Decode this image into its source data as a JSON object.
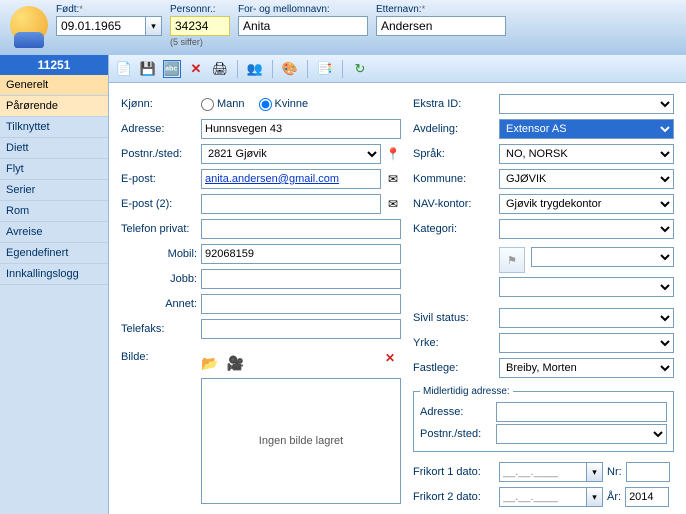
{
  "header": {
    "fodt_label": "Født:",
    "fodt_value": "09.01.1965",
    "personnr_label": "Personnr.:",
    "personnr_value": "34234",
    "personnr_hint": "(5 siffer)",
    "fornavn_label": "For- og mellomnavn:",
    "fornavn_value": "Anita",
    "etternavn_label": "Etternavn:",
    "etternavn_value": "Andersen",
    "required_marker": "*"
  },
  "sidebar": {
    "id": "11251",
    "items": [
      {
        "label": "Generelt",
        "active": true
      },
      {
        "label": "Pårørende",
        "highlight": true
      },
      {
        "label": "Tilknyttet"
      },
      {
        "label": "Diett"
      },
      {
        "label": "Flyt"
      },
      {
        "label": "Serier"
      },
      {
        "label": "Rom"
      },
      {
        "label": "Avreise"
      },
      {
        "label": "Egendefinert"
      },
      {
        "label": "Innkallingslogg"
      }
    ]
  },
  "toolbar_icons": [
    "new",
    "save",
    "card",
    "delete",
    "print",
    "users",
    "palette",
    "transfer",
    "refresh"
  ],
  "form_left": {
    "kjonn_label": "Kjønn:",
    "kjonn_mann": "Mann",
    "kjonn_kvinne": "Kvinne",
    "kjonn_value": "Kvinne",
    "adresse_label": "Adresse:",
    "adresse_value": "Hunnsvegen 43",
    "postnr_label": "Postnr./sted:",
    "postnr_value": "2821 Gjøvik",
    "epost_label": "E-post:",
    "epost_value": "anita.andersen@gmail.com",
    "epost2_label": "E-post (2):",
    "epost2_value": "",
    "telefon_label": "Telefon privat:",
    "telefon_value": "",
    "mobil_label": "Mobil:",
    "mobil_value": "92068159",
    "jobb_label": "Jobb:",
    "jobb_value": "",
    "annet_label": "Annet:",
    "annet_value": "",
    "telefaks_label": "Telefaks:",
    "telefaks_value": "",
    "bilde_label": "Bilde:",
    "bilde_placeholder": "Ingen bilde lagret"
  },
  "form_right": {
    "ekstraid_label": "Ekstra ID:",
    "ekstraid_value": "",
    "avdeling_label": "Avdeling:",
    "avdeling_value": "Extensor AS",
    "sprak_label": "Språk:",
    "sprak_value": "NO, NORSK",
    "kommune_label": "Kommune:",
    "kommune_value": "GJØVIK",
    "nav_label": "NAV-kontor:",
    "nav_value": "Gjøvik trygdekontor",
    "kategori_label": "Kategori:",
    "kategori_value": "",
    "sivil_label": "Sivil status:",
    "sivil_value": "",
    "yrke_label": "Yrke:",
    "yrke_value": "",
    "fastlege_label": "Fastlege:",
    "fastlege_value": "Breiby, Morten",
    "midlertidig_legend": "Midlertidig adresse:",
    "m_adresse_label": "Adresse:",
    "m_adresse_value": "",
    "m_postnr_label": "Postnr./sted:",
    "m_postnr_value": "",
    "frikort1_label": "Frikort 1 dato:",
    "frikort1_value": "__.__.____",
    "frikort1_nr_label": "Nr:",
    "frikort1_nr_value": "",
    "frikort2_label": "Frikort 2 dato:",
    "frikort2_value": "__.__.____",
    "frikort2_ar_label": "År:",
    "frikort2_ar_value": "2014"
  }
}
